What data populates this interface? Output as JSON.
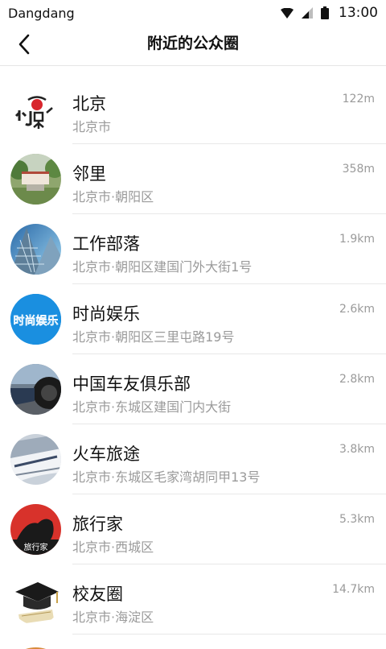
{
  "status_bar": {
    "carrier": "Dangdang",
    "time": "13:00"
  },
  "header": {
    "title": "附近的公众圈"
  },
  "items": [
    {
      "name": "北京",
      "address": "北京市",
      "distance": "122m",
      "icon": "beijing-logo"
    },
    {
      "name": "邻里",
      "address": "北京市·朝阳区",
      "distance": "358m",
      "icon": "neighborhood-photo"
    },
    {
      "name": "工作部落",
      "address": "北京市·朝阳区建国门外大街1号",
      "distance": "1.9km",
      "icon": "skyscraper-photo"
    },
    {
      "name": "时尚娱乐",
      "address": "北京市·朝阳区三里屯路19号",
      "distance": "2.6km",
      "icon": "fashion-logo",
      "icon_text": "时尚娱乐"
    },
    {
      "name": "中国车友俱乐部",
      "address": "北京市·东城区建国门内大街",
      "distance": "2.8km",
      "icon": "car-photo"
    },
    {
      "name": "火车旅途",
      "address": "北京市·东城区毛家湾胡同甲13号",
      "distance": "3.8km",
      "icon": "train-photo"
    },
    {
      "name": "旅行家",
      "address": "北京市·西城区",
      "distance": "5.3km",
      "icon": "traveler-logo",
      "icon_text": "旅行家"
    },
    {
      "name": "校友圈",
      "address": "北京市·海淀区",
      "distance": "14.7km",
      "icon": "graduation-cap"
    }
  ],
  "colors": {
    "divider": "#e8e8e8",
    "secondary_text": "#9a9a9a",
    "fashion_blue": "#1a8fe0",
    "traveler_red": "#d8322b"
  }
}
